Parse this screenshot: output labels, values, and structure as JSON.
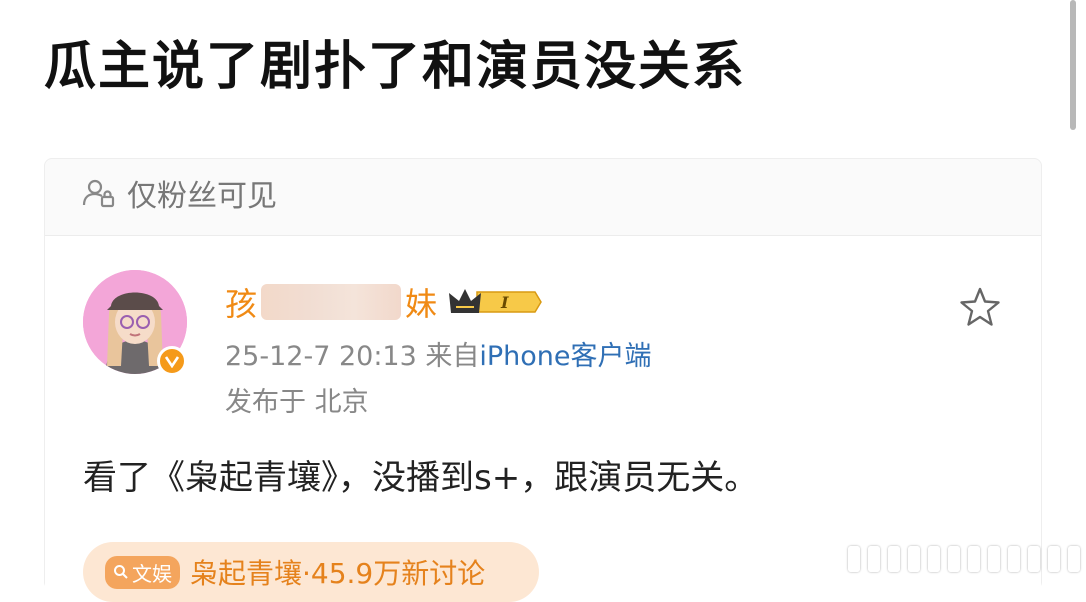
{
  "headline": "瓜主说了剧扑了和演员没关系",
  "visibility": {
    "label": "仅粉丝可见",
    "icon": "lock-person-icon"
  },
  "post": {
    "username_start": "孩",
    "username_end": "妹",
    "level_badge": "I",
    "date": "25-12-7 20:13",
    "from_prefix": "来自",
    "client": "iPhone客户端",
    "location": "发布于 北京",
    "text": "看了《枭起青壤》，没播到s+，跟演员无关。"
  },
  "topic": {
    "tag": "文娱",
    "text": "枭起青壤·45.9万新讨论"
  },
  "colors": {
    "accent": "#f08a14",
    "link": "#2f6fb5",
    "topic_bg": "#fde7d3"
  }
}
